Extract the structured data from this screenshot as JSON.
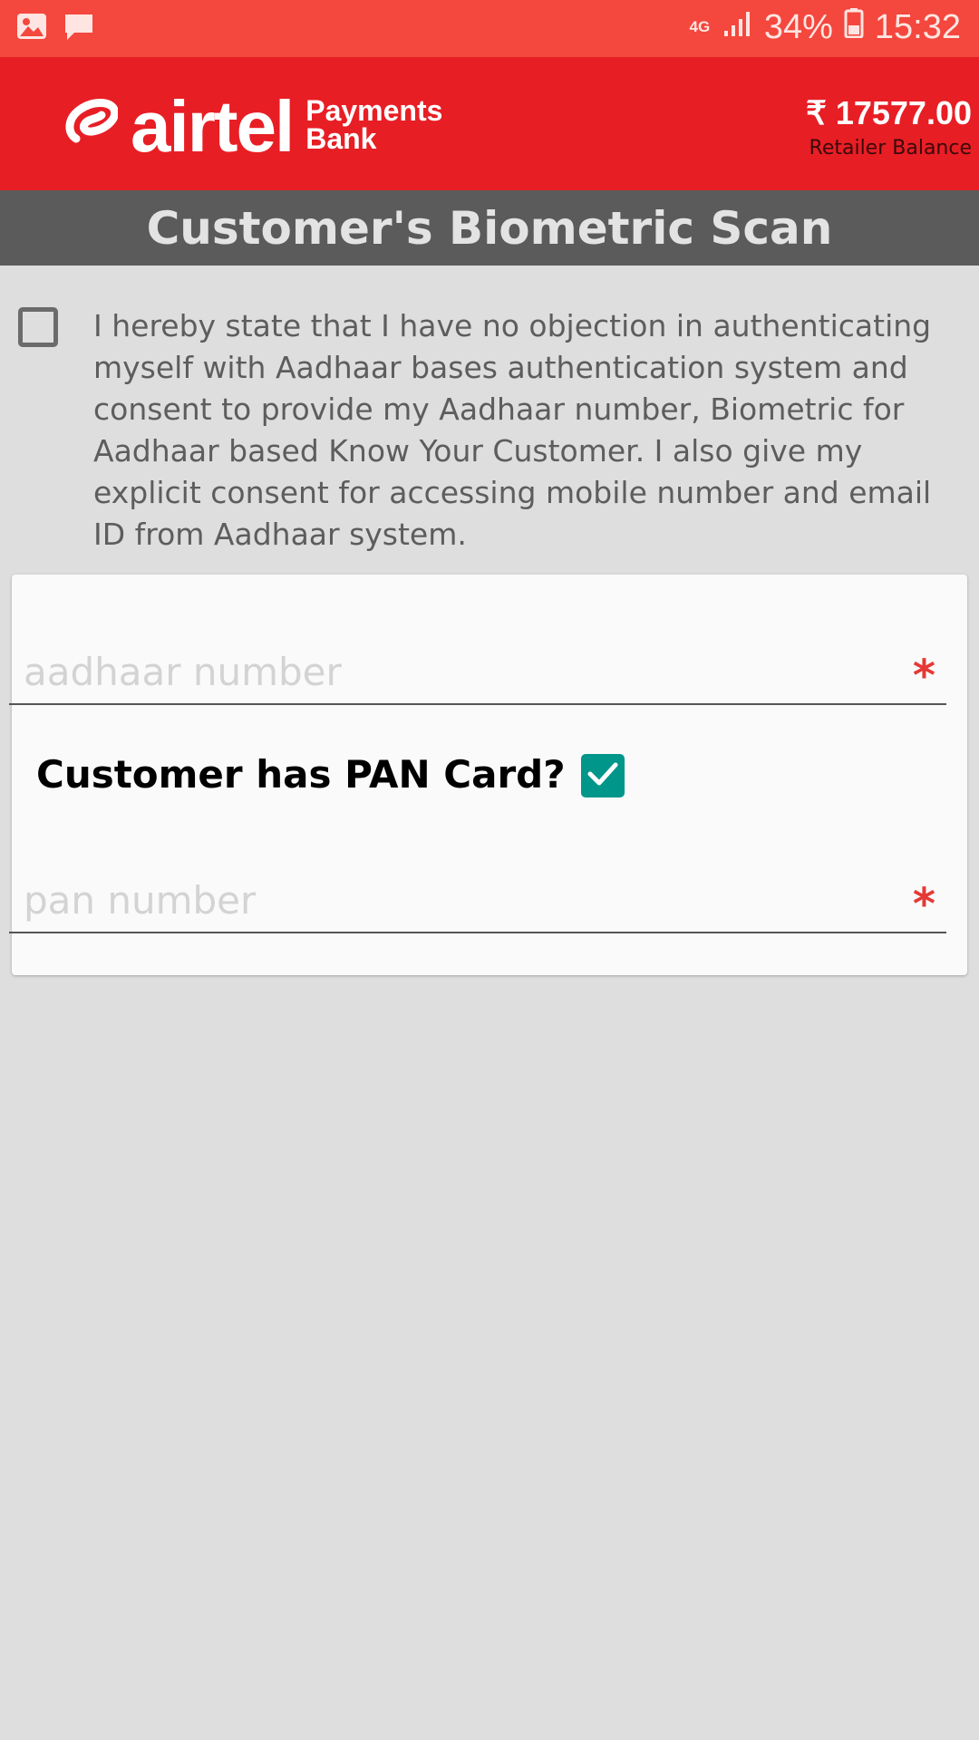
{
  "status_bar": {
    "network": "4G",
    "battery": "34%",
    "time": "15:32",
    "icons": [
      "image-notification-icon",
      "message-notification-icon",
      "signal-icon",
      "battery-icon"
    ]
  },
  "header": {
    "logo_word": "airtel",
    "logo_sub_line1": "Payments",
    "logo_sub_line2": "Bank",
    "balance_amount": "₹ 17577.00",
    "balance_label": "Retailer Balance"
  },
  "title": "Customer's Biometric Scan",
  "consent": {
    "checked": false,
    "text": "I hereby state that I have no objection in authenticating myself with Aadhaar bases authentication system and consent to provide my Aadhaar number, Biometric for Aadhaar based Know Your Customer. I also give my explicit consent for accessing mobile number and email ID from Aadhaar system."
  },
  "form": {
    "aadhaar": {
      "placeholder": "aadhaar number",
      "value": "",
      "required_mark": "*"
    },
    "pan_question": "Customer has PAN Card?",
    "pan_checked": true,
    "pan": {
      "placeholder": "pan number",
      "value": "",
      "required_mark": "*"
    }
  },
  "colors": {
    "status_bar": "#f4473d",
    "header": "#e81e25",
    "title_bar": "#5b5b5b",
    "checkbox_checked": "#00968a",
    "required": "#e53935"
  }
}
